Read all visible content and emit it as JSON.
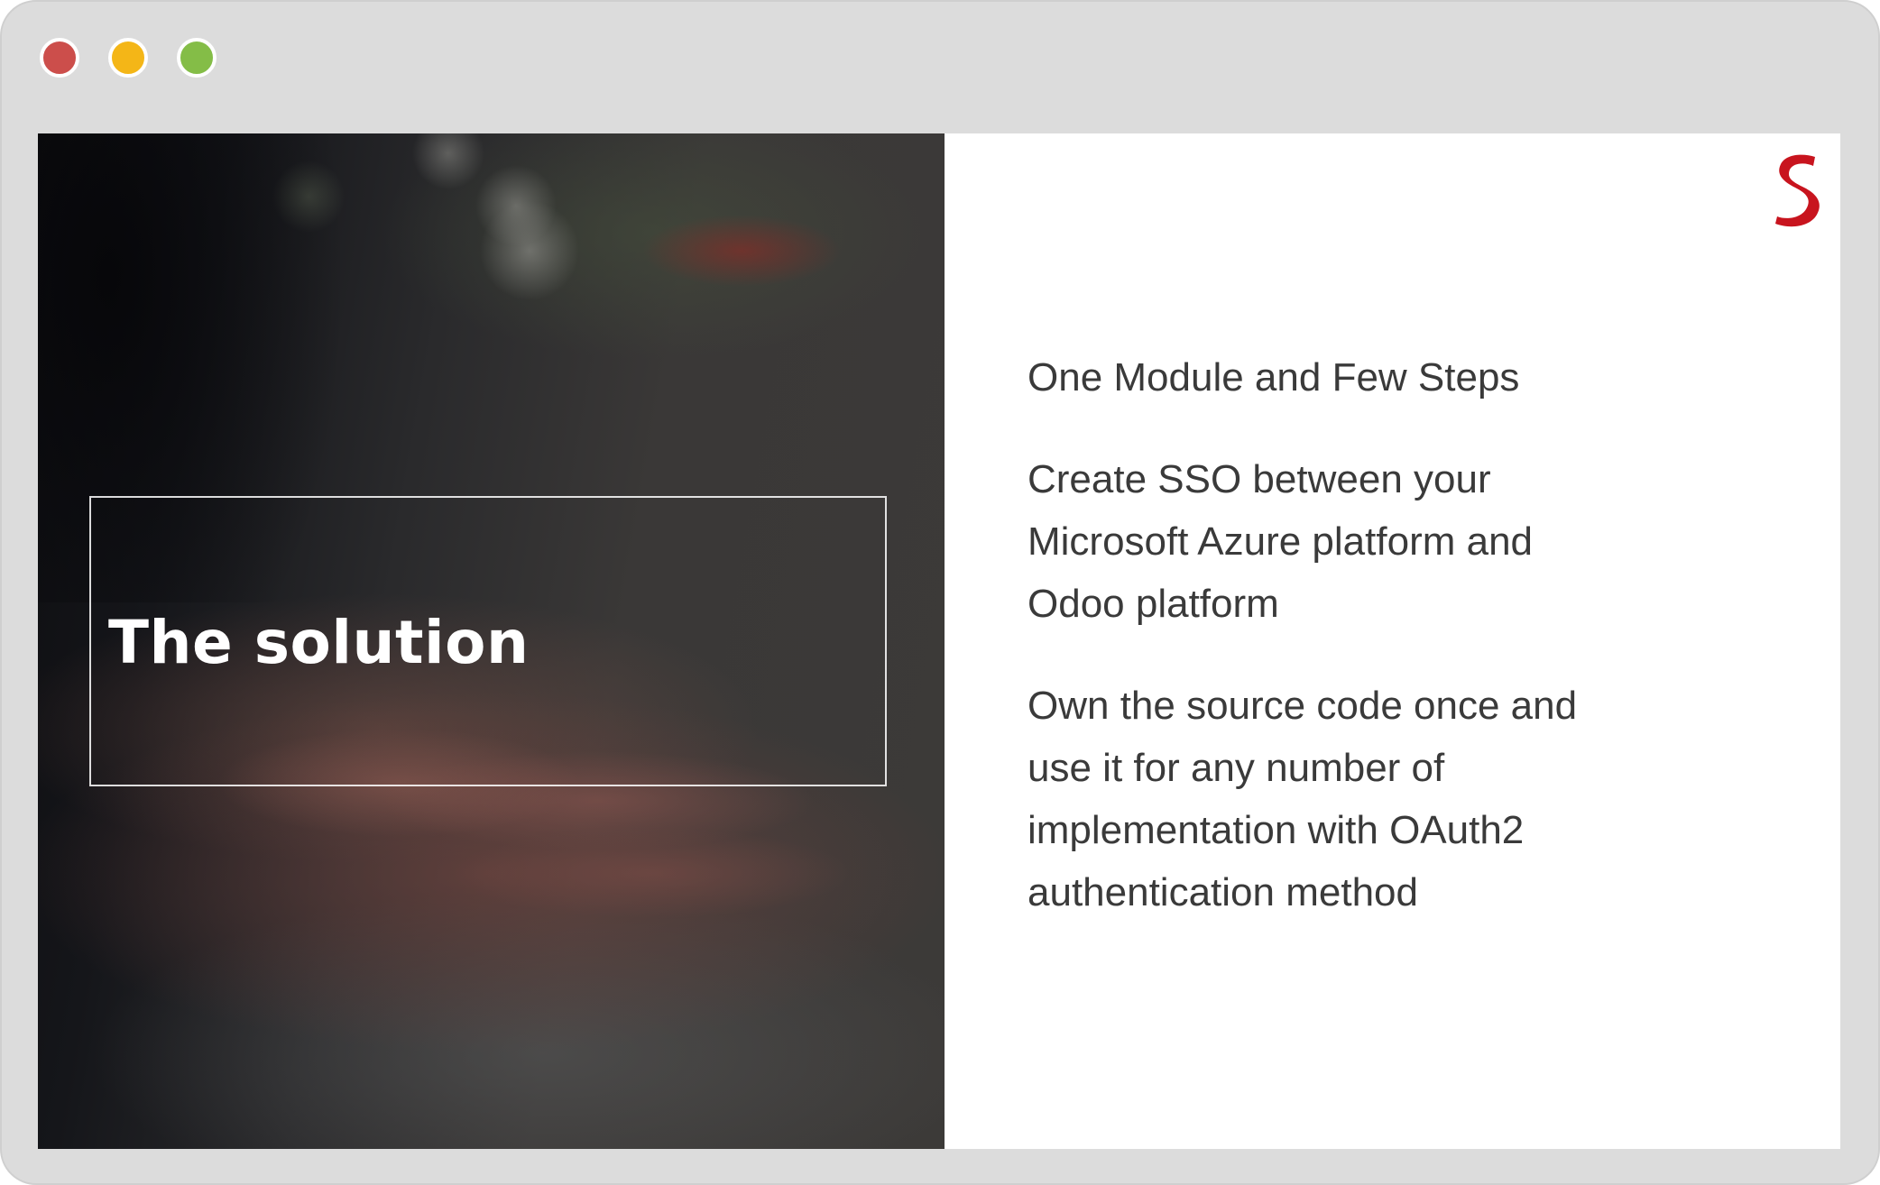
{
  "window": {
    "controls": [
      "close",
      "minimize",
      "zoom"
    ]
  },
  "slide": {
    "title": "The solution",
    "logo_icon": "brand-s-logo-icon",
    "points": [
      {
        "lines": [
          "One Module and Few Steps"
        ]
      },
      {
        "lines": [
          "Create SSO between your",
          "Microsoft Azure platform and",
          "Odoo platform"
        ]
      },
      {
        "lines": [
          "Own the source code once and",
          "use it for any number of",
          "implementation with OAuth2",
          "authentication method"
        ]
      }
    ]
  },
  "colors": {
    "close": "#cc4e4b",
    "minimize": "#f4b617",
    "zoom": "#84bd47",
    "logo": "#c8141e",
    "frame": "#dcdcdc",
    "body_text": "#3a3a3a"
  }
}
